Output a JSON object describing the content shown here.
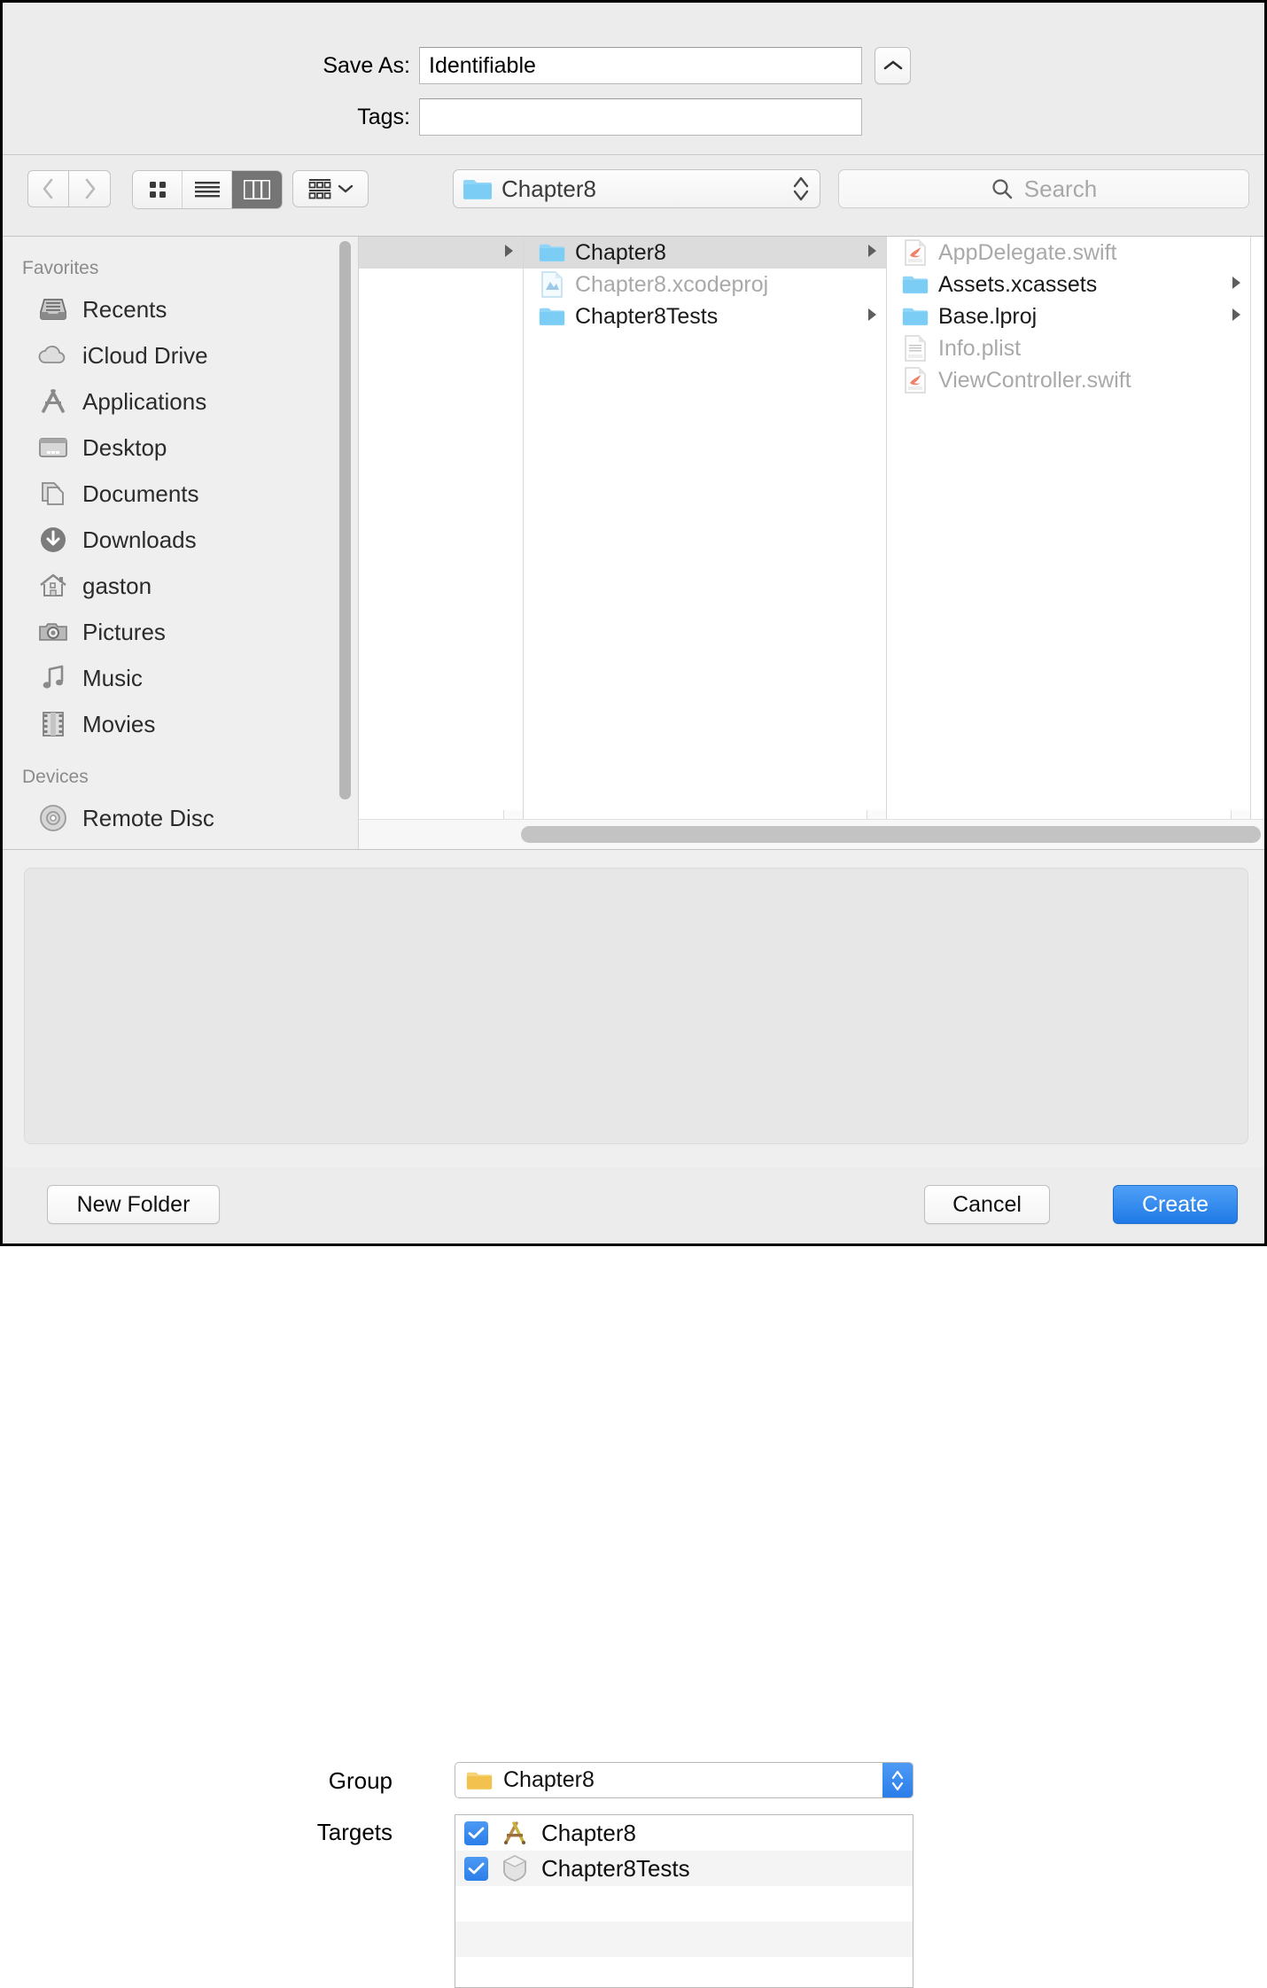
{
  "save_as": {
    "label": "Save As:",
    "value": "Identifiable",
    "expand_icon": "chevron-up-icon"
  },
  "tags": {
    "label": "Tags:",
    "value": "",
    "placeholder": ""
  },
  "toolbar": {
    "back_icon": "chevron-left-icon",
    "forward_icon": "chevron-right-icon",
    "view_icon_grid": "icon-view-icon",
    "view_list": "list-view-icon",
    "view_column": "column-view-icon",
    "active_view": "column",
    "group_by_icon": "group-by-icon",
    "group_by_chevron": "chevron-down-icon",
    "path": {
      "icon": "blue-folder-icon",
      "label": "Chapter8",
      "stepper_icon": "stepper-updown-icon"
    },
    "search": {
      "icon": "search-icon",
      "placeholder": "Search",
      "value": ""
    }
  },
  "sidebar": {
    "sections": [
      {
        "title": "Favorites",
        "items": [
          {
            "label": "Recents",
            "icon": "recents-icon"
          },
          {
            "label": "iCloud Drive",
            "icon": "cloud-icon"
          },
          {
            "label": "Applications",
            "icon": "applications-icon"
          },
          {
            "label": "Desktop",
            "icon": "desktop-icon"
          },
          {
            "label": "Documents",
            "icon": "documents-icon"
          },
          {
            "label": "Downloads",
            "icon": "downloads-icon"
          },
          {
            "label": "gaston",
            "icon": "home-icon"
          },
          {
            "label": "Pictures",
            "icon": "camera-icon"
          },
          {
            "label": "Music",
            "icon": "music-note-icon"
          },
          {
            "label": "Movies",
            "icon": "film-icon"
          }
        ]
      },
      {
        "title": "Devices",
        "items": [
          {
            "label": "Remote Disc",
            "icon": "disc-icon"
          }
        ]
      }
    ]
  },
  "browser": {
    "column1": [
      {
        "label": "",
        "icon": "none",
        "selected": true,
        "disclosure": true,
        "dimmed": false
      }
    ],
    "column2": [
      {
        "label": "Chapter8",
        "icon": "blue-folder-icon",
        "selected": true,
        "disclosure": true,
        "dimmed": false
      },
      {
        "label": "Chapter8.xcodeproj",
        "icon": "xcodeproj-file-icon",
        "selected": false,
        "disclosure": false,
        "dimmed": true
      },
      {
        "label": "Chapter8Tests",
        "icon": "blue-folder-icon",
        "selected": false,
        "disclosure": true,
        "dimmed": false
      }
    ],
    "column3": [
      {
        "label": "AppDelegate.swift",
        "icon": "swift-file-icon",
        "selected": false,
        "disclosure": false,
        "dimmed": true
      },
      {
        "label": "Assets.xcassets",
        "icon": "blue-folder-icon",
        "selected": false,
        "disclosure": true,
        "dimmed": false
      },
      {
        "label": "Base.lproj",
        "icon": "blue-folder-icon",
        "selected": false,
        "disclosure": true,
        "dimmed": false
      },
      {
        "label": "Info.plist",
        "icon": "plist-file-icon",
        "selected": false,
        "disclosure": false,
        "dimmed": true
      },
      {
        "label": "ViewController.swift",
        "icon": "swift-file-icon",
        "selected": false,
        "disclosure": false,
        "dimmed": true
      }
    ]
  },
  "accessory": {
    "group": {
      "label": "Group",
      "icon": "yellow-folder-icon",
      "value": "Chapter8",
      "stepper_icon": "stepper-updown-icon"
    },
    "targets": {
      "label": "Targets",
      "rows": [
        {
          "name": "Chapter8",
          "checked": true,
          "icon": "xcode-app-icon"
        },
        {
          "name": "Chapter8Tests",
          "checked": true,
          "icon": "test-bundle-icon"
        }
      ]
    }
  },
  "footer": {
    "new_folder": "New Folder",
    "cancel": "Cancel",
    "create": "Create"
  },
  "colors": {
    "accent_blue": "#2b7ee9",
    "folder_blue": "#7fd0f5",
    "folder_yellow": "#f2c14e",
    "window_gray": "#ececec",
    "selection_gray": "#dcdcdc"
  }
}
